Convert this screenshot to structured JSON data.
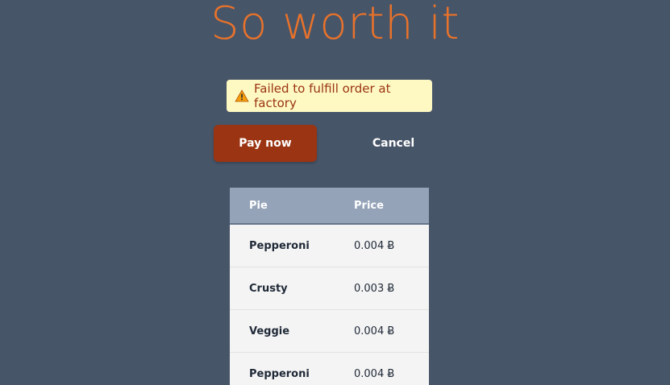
{
  "title": "So worth it",
  "alert": {
    "icon": "warning-icon",
    "message": "Failed to fulfill order at factory"
  },
  "actions": {
    "pay_label": "Pay now",
    "cancel_label": "Cancel"
  },
  "table": {
    "headers": [
      "Pie",
      "Price"
    ],
    "rows": [
      {
        "pie": "Pepperoni",
        "price": "0.004 Ƀ"
      },
      {
        "pie": "Crusty",
        "price": "0.003 Ƀ"
      },
      {
        "pie": "Veggie",
        "price": "0.004 Ƀ"
      },
      {
        "pie": "Pepperoni",
        "price": "0.004 Ƀ"
      }
    ]
  },
  "colors": {
    "background": "#475569",
    "title": "#e8722a",
    "pay_button": "#9a3412",
    "alert_bg": "#fef9c3"
  }
}
